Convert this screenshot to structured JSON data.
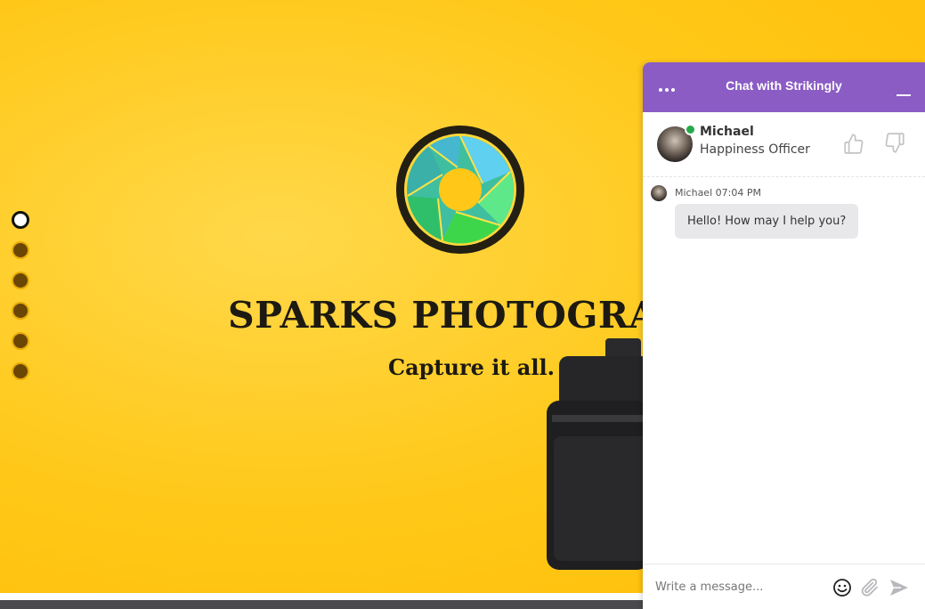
{
  "hero": {
    "title": "SPARKS PHOTOGRAPHY",
    "subtitle": "Capture it all.",
    "nav_dots": [
      {
        "label": "section-1",
        "active": true
      },
      {
        "label": "section-2",
        "active": false
      },
      {
        "label": "section-3",
        "active": false
      },
      {
        "label": "section-4",
        "active": false
      },
      {
        "label": "section-5",
        "active": false
      },
      {
        "label": "section-6",
        "active": false
      }
    ]
  },
  "chat": {
    "title": "Chat with Strikingly",
    "accent_color": "#8a5cc4",
    "agent": {
      "name": "Michael",
      "role": "Happiness Officer",
      "status": "online"
    },
    "messages": [
      {
        "sender": "Michael",
        "time": "07:04 PM",
        "text": "Hello! How may I help you?"
      }
    ],
    "composer": {
      "placeholder": "Write a message...",
      "icons": [
        "emoji-icon",
        "paperclip-icon",
        "send-icon"
      ]
    }
  }
}
